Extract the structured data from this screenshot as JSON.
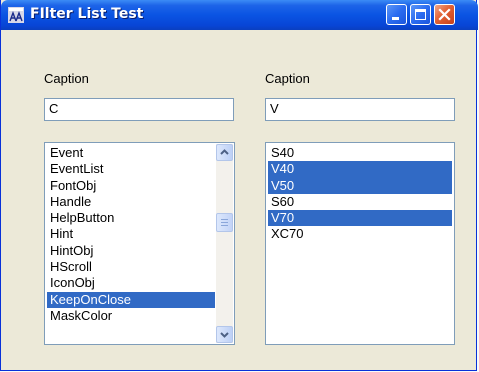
{
  "window": {
    "title": "FIlter List Test"
  },
  "left": {
    "caption": "Caption",
    "filter_value": "C",
    "items": [
      {
        "label": "Event",
        "selected": false
      },
      {
        "label": "EventList",
        "selected": false
      },
      {
        "label": "FontObj",
        "selected": false
      },
      {
        "label": "Handle",
        "selected": false
      },
      {
        "label": "HelpButton",
        "selected": false
      },
      {
        "label": "Hint",
        "selected": false
      },
      {
        "label": "HintObj",
        "selected": false
      },
      {
        "label": "HScroll",
        "selected": false
      },
      {
        "label": "IconObj",
        "selected": false
      },
      {
        "label": "KeepOnClose",
        "selected": true
      },
      {
        "label": "MaskColor",
        "selected": false
      }
    ]
  },
  "right": {
    "caption": "Caption",
    "filter_value": "V",
    "items": [
      {
        "label": "S40",
        "selected": false
      },
      {
        "label": "V40",
        "selected": true
      },
      {
        "label": "V50",
        "selected": true
      },
      {
        "label": "S60",
        "selected": false
      },
      {
        "label": "V70",
        "selected": true
      },
      {
        "label": "XC70",
        "selected": false
      }
    ]
  },
  "colors": {
    "selection": "#316ac5",
    "titlebar": "#0a54e3",
    "window_face": "#ece9d8"
  },
  "icons": {
    "app": "app-icon",
    "minimize": "minimize-icon",
    "maximize": "maximize-icon",
    "close": "close-icon",
    "scroll_up": "chevron-up-icon",
    "scroll_down": "chevron-down-icon"
  }
}
